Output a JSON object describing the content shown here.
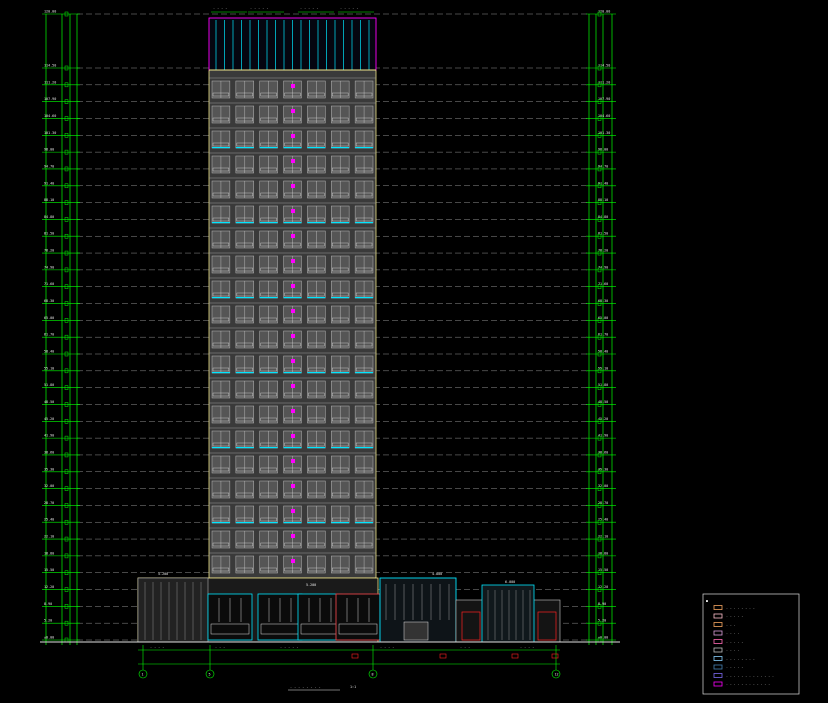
{
  "drawing": {
    "background": "#000000",
    "colors": {
      "grid_green": "#00ff00",
      "level_line": "#d0d0d0",
      "tower_outline": "#f0e68c",
      "tower_fill": "#3a3a3a",
      "window_frame": "#b8b8b8",
      "accent_magenta": "#ff00ff",
      "accent_cyan": "#00e5ff",
      "accent_red": "#ff2020",
      "legend_border": "#e0e0e0"
    },
    "title_label": "- - - - - - - -",
    "scale_label": "1:1",
    "top_dims": [
      "- - - -",
      "- - - - -",
      "- - - - -",
      "- - - - -"
    ],
    "left_elevations": [
      "120.00",
      "114.50",
      "111.20",
      "107.90",
      "104.60",
      "101.30",
      "98.00",
      "94.70",
      "91.40",
      "88.10",
      "84.80",
      "81.50",
      "78.20",
      "74.90",
      "71.60",
      "68.30",
      "65.00",
      "61.70",
      "58.40",
      "55.10",
      "51.80",
      "48.50",
      "45.20",
      "41.90",
      "38.60",
      "35.30",
      "32.00",
      "28.70",
      "25.40",
      "22.10",
      "18.80",
      "15.50",
      "12.20",
      "8.90",
      "5.20",
      "±0.00"
    ],
    "right_elevations": [
      "120.00",
      "114.50",
      "111.20",
      "107.90",
      "104.60",
      "101.30",
      "98.00",
      "94.70",
      "91.40",
      "88.10",
      "84.80",
      "81.50",
      "78.20",
      "74.90",
      "71.60",
      "68.30",
      "65.00",
      "61.70",
      "58.40",
      "55.10",
      "51.80",
      "48.50",
      "45.20",
      "41.90",
      "38.60",
      "35.30",
      "32.00",
      "28.70",
      "25.40",
      "22.10",
      "18.80",
      "15.50",
      "12.20",
      "8.90",
      "5.20",
      "±0.00"
    ],
    "bottom_axes": [
      "1",
      "5",
      "8",
      "12"
    ],
    "bottom_dims": [
      "- - - -",
      "- - -",
      "- - - - -",
      "- - - -",
      "- - -",
      "- - - -"
    ],
    "podium_labels": [
      "5.200",
      "5.200",
      "4.800",
      "6.000"
    ]
  },
  "legend": {
    "items": [
      {
        "label": "- - - - - - - -",
        "color": "#f4a460"
      },
      {
        "label": "- - - - -",
        "color": "#ffc0cb"
      },
      {
        "label": "- - -",
        "color": "#f4a460"
      },
      {
        "label": "- - - -",
        "color": "#dda0dd"
      },
      {
        "label": "- - - - -",
        "color": "#ff69b4"
      },
      {
        "label": "- - - -",
        "color": "#c0c0c0"
      },
      {
        "label": "- - - - - - - -",
        "color": "#87cefa"
      },
      {
        "label": "- - - - -",
        "color": "#4682b4"
      },
      {
        "label": "- - - - - - - - - - - - -",
        "color": "#7b68ee"
      },
      {
        "label": "- - - - - - - - - - - -",
        "color": "#ff00ff"
      }
    ]
  }
}
